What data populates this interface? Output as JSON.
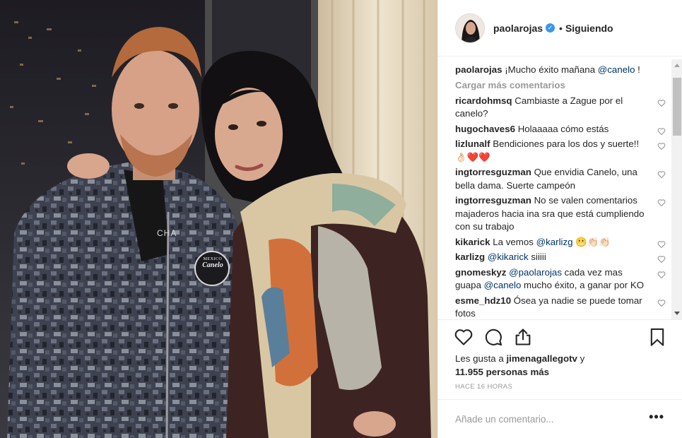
{
  "post": {
    "photo_badge_lines": [
      "MEXICO",
      "Canelo"
    ],
    "photo_shirt_text": "CHA"
  },
  "header": {
    "username": "paolarojas",
    "verified_glyph": "✓",
    "separator": "•",
    "follow_status": "Siguiendo"
  },
  "caption": {
    "username": "paolarojas",
    "text_before": "¡Mucho éxito mañana ",
    "mention": "@canelo",
    "text_after": " !"
  },
  "load_more": "Cargar más comentarios",
  "comments": [
    {
      "user": "ricardohmsq",
      "segments": [
        {
          "t": "Cambiaste a Zague por el canelo?"
        }
      ]
    },
    {
      "user": "hugochaves6",
      "segments": [
        {
          "t": "Holaaaaa cómo estás"
        }
      ]
    },
    {
      "user": "lizlunalf",
      "segments": [
        {
          "t": "Bendiciones para los dos y suerte!! 👌🏻❤️❤️"
        }
      ]
    },
    {
      "user": "ingtorresguzman",
      "segments": [
        {
          "t": "Que envidia Canelo, una bella dama. Suerte campeón"
        }
      ]
    },
    {
      "user": "ingtorresguzman",
      "segments": [
        {
          "t": "No se valen comentarios majaderos hacia ina sra que está cumpliendo con su trabajo"
        }
      ]
    },
    {
      "user": "kikarick",
      "segments": [
        {
          "t": "La vemos "
        },
        {
          "m": "@karlizg"
        },
        {
          "t": " 😬👏🏻👏🏻"
        }
      ]
    },
    {
      "user": "karlizg",
      "segments": [
        {
          "m": "@kikarick"
        },
        {
          "t": " siiiii"
        }
      ]
    },
    {
      "user": "gnomeskyz",
      "segments": [
        {
          "m": "@paolarojas"
        },
        {
          "t": " cada vez mas guapa "
        },
        {
          "m": "@canelo"
        },
        {
          "t": " mucho éxito, a ganar por KO"
        }
      ]
    },
    {
      "user": "esme_hdz10",
      "segments": [
        {
          "t": "Ósea ya nadie se puede tomar fotos"
        }
      ]
    }
  ],
  "likes": {
    "prefix": "Les gusta a ",
    "first_user": "jimenagallegotv",
    "connector": " y",
    "count": "11.955",
    "suffix": "personas más"
  },
  "timestamp": "HACE 16 HORAS",
  "add_comment_placeholder": "Añade un comentario...",
  "more_glyph": "•••",
  "icons": {
    "like": "heart-outline-icon",
    "comment": "speech-bubble-icon",
    "share": "share-arrow-icon",
    "save": "bookmark-icon",
    "comment_like": "small-heart-icon",
    "verified": "verified-badge-icon"
  },
  "colors": {
    "text": "#262626",
    "secondary": "#999999",
    "mention": "#003569",
    "verified": "#3897f0",
    "divider": "#efefef"
  }
}
